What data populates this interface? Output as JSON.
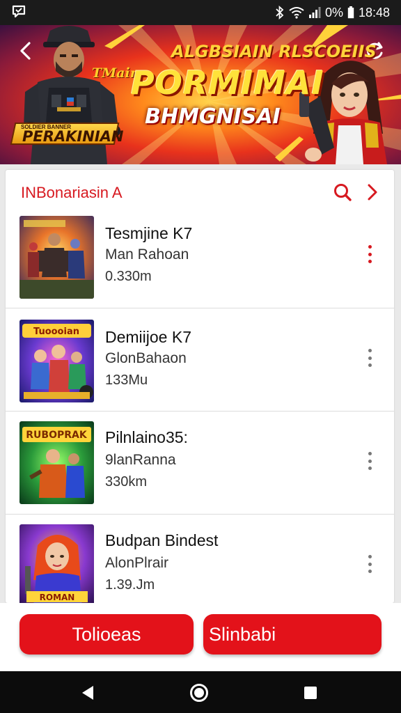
{
  "status_bar": {
    "battery_text": "0%",
    "time": "18:48"
  },
  "banner": {
    "tag": "TMain",
    "subtitle": "ALGBSIAIN RLSCOEIIS",
    "title": "PORMIMAI",
    "title2": "BHMGNISAI",
    "ribbon_text": "PERAKINIAN",
    "ribbon_small": "SOLDIER BANNER"
  },
  "list_card": {
    "title": "INBonariasin A",
    "items": [
      {
        "name": "Tesmjine K7",
        "developer": "Man Rahoan",
        "size": "0.330m",
        "more_icon": "more-vertical-red"
      },
      {
        "name": "Demiijoe K7",
        "developer": "GlonBahaon",
        "size": "133Mu",
        "more_icon": "more-vertical-grey"
      },
      {
        "name": "Pilnlaino35:",
        "developer": "9lanRanna",
        "size": "330km",
        "more_icon": "more-vertical-grey"
      },
      {
        "name": "Budpan Bindest",
        "developer": "AlonPlrair",
        "size": "1.39.Jm",
        "more_icon": "more-vertical-grey"
      }
    ],
    "thumb_labels": [
      "",
      "Tuoooian",
      "RUBOPRAK",
      "ROMAN"
    ]
  },
  "actions": {
    "left_label": "Tolioeas",
    "right_label": "Slinbabi"
  },
  "colors": {
    "accent": "#e3121a",
    "title_red": "#d71920"
  }
}
